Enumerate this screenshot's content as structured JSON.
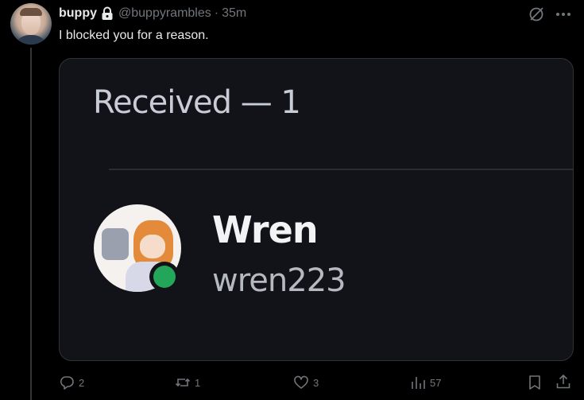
{
  "tweet": {
    "display_name": "buppy",
    "handle": "@buppyrambles",
    "separator": "·",
    "time": "35m",
    "text": "I blocked you for a reason."
  },
  "media": {
    "received_label": "Received — 1",
    "friend": {
      "name": "Wren",
      "username": "wren223",
      "status": "online",
      "status_color": "#23a55a"
    }
  },
  "actions": {
    "replies": "2",
    "reposts": "1",
    "likes": "3",
    "views": "57"
  },
  "icons": {
    "lock": "lock-icon",
    "grok": "grok-icon",
    "more": "more-icon",
    "reply": "reply-icon",
    "repost": "repost-icon",
    "like": "heart-icon",
    "views": "views-icon",
    "bookmark": "bookmark-icon",
    "share": "share-icon"
  },
  "colors": {
    "background": "#000000",
    "text_primary": "#e7e9ea",
    "text_secondary": "#71767b",
    "card_background": "#121318"
  }
}
